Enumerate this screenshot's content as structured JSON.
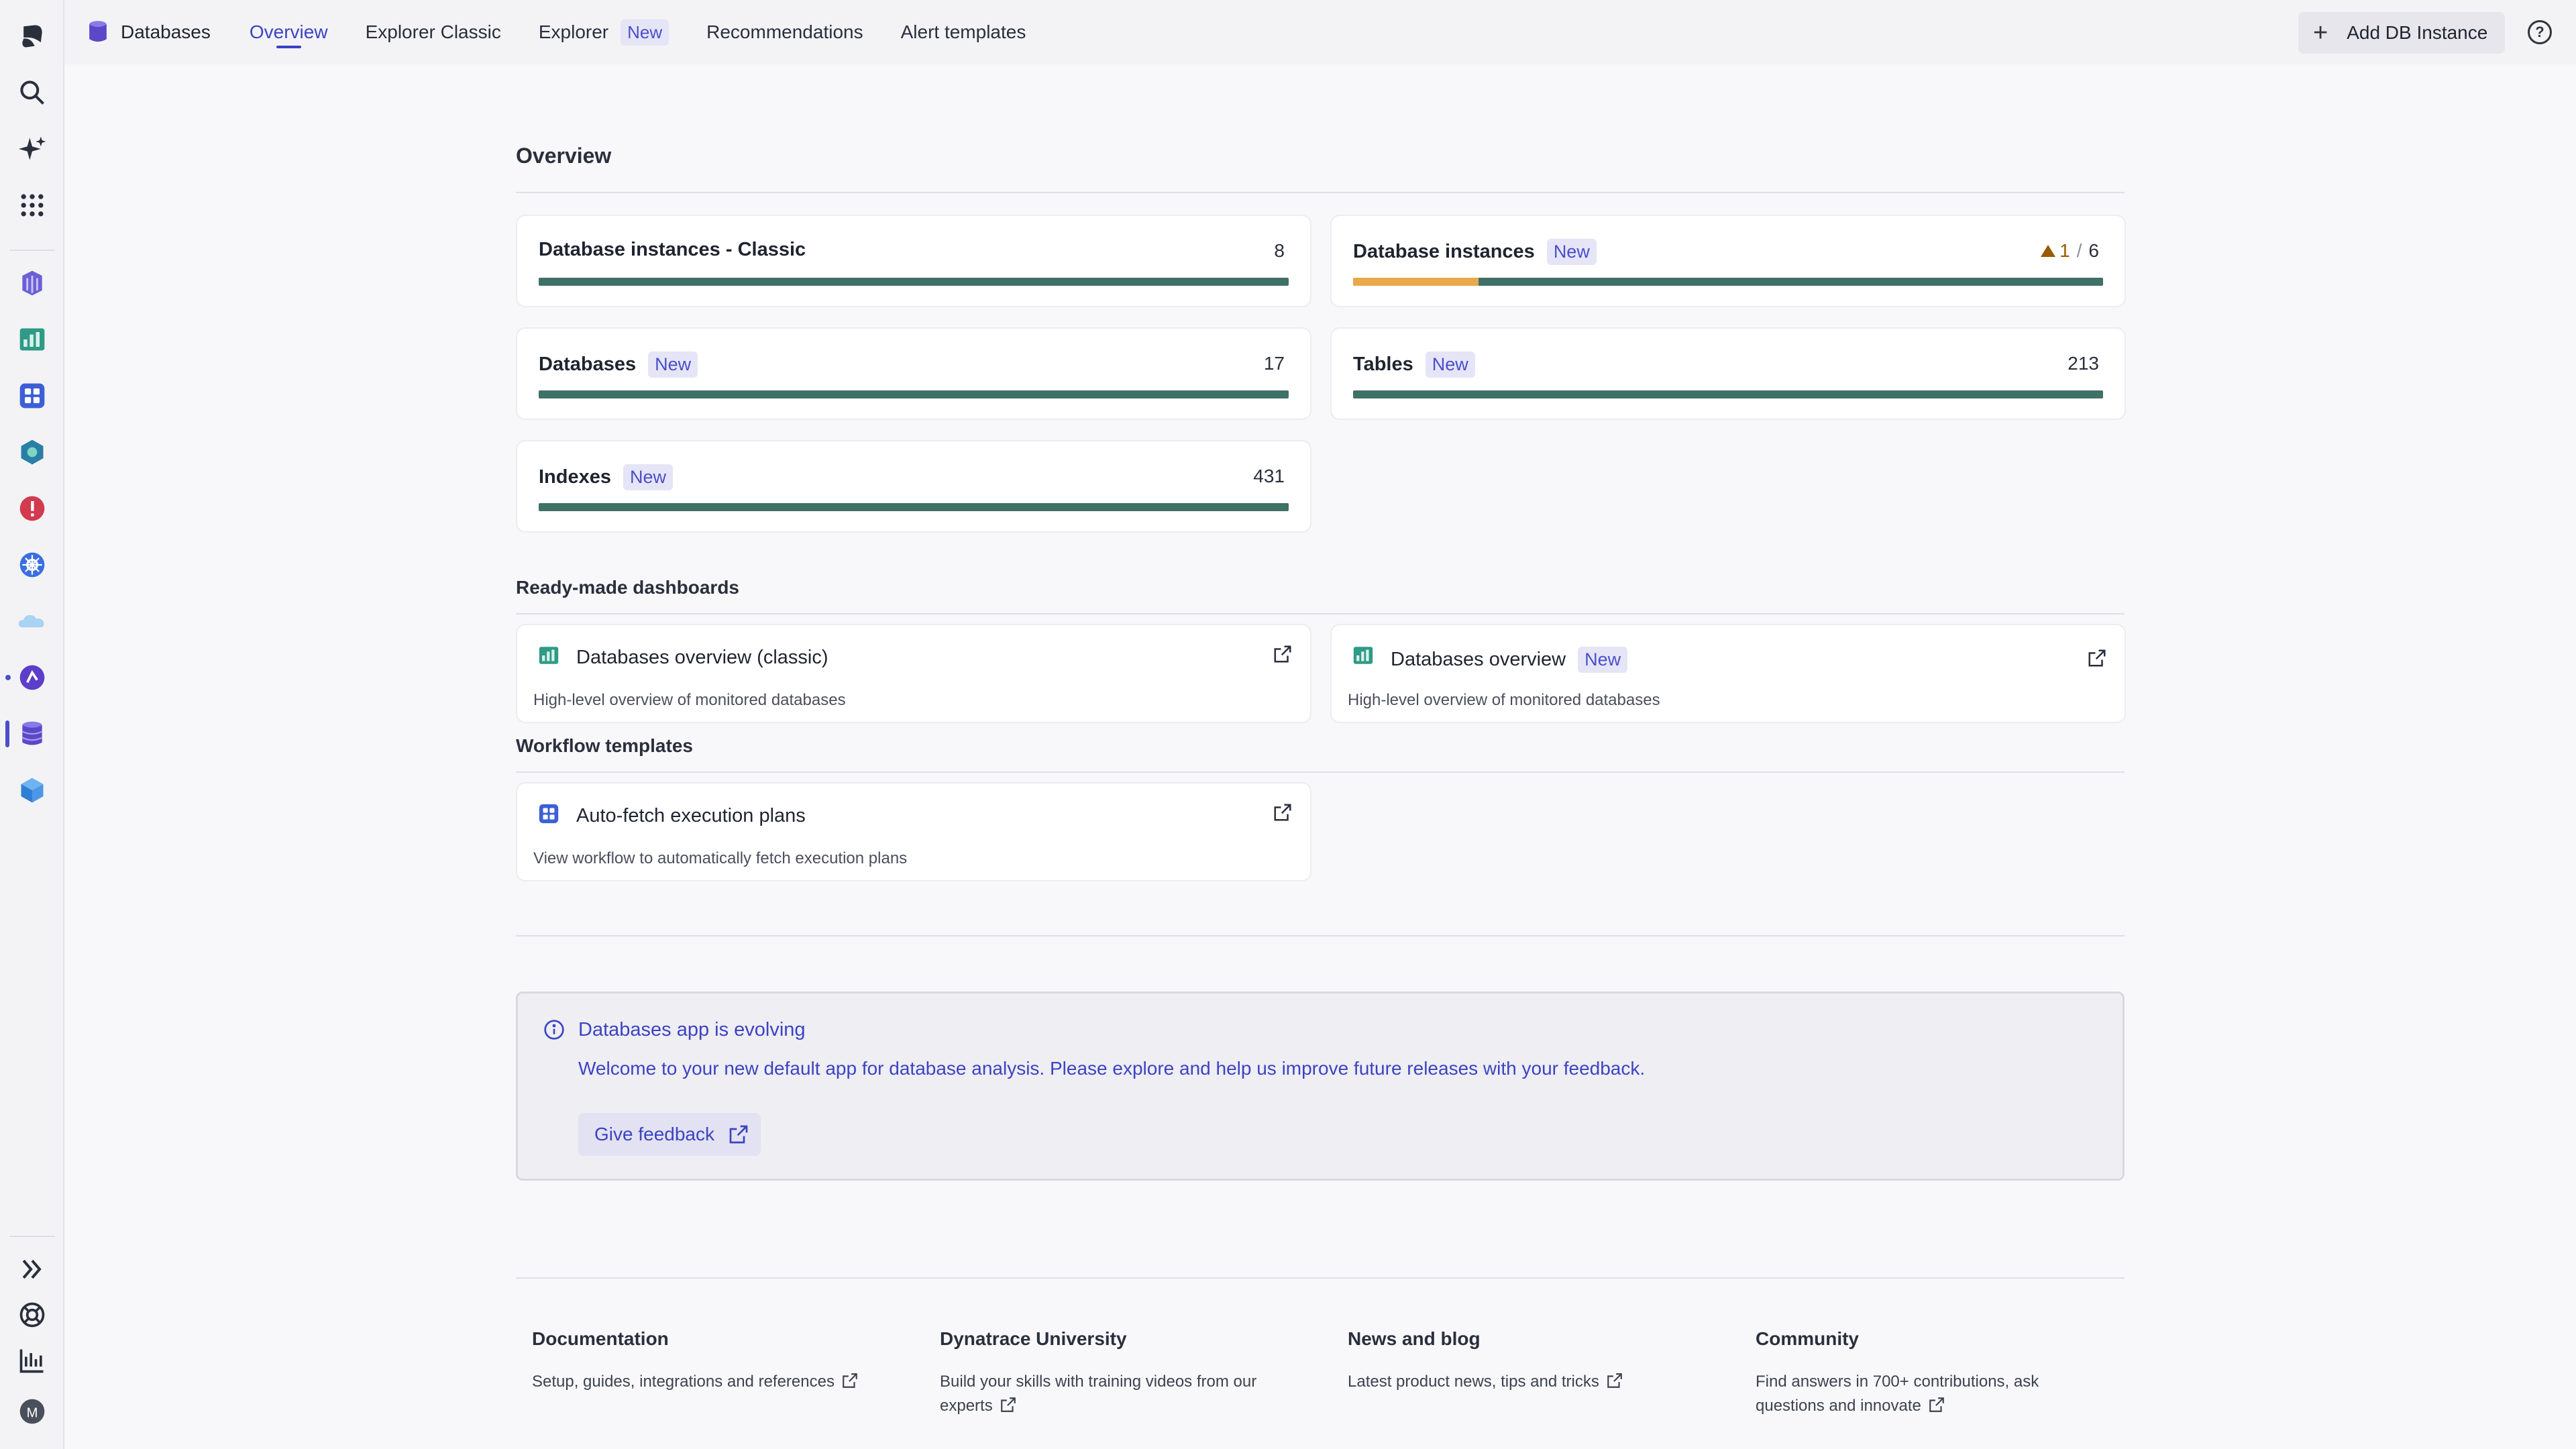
{
  "app": {
    "title": "Databases",
    "tabs": [
      {
        "label": "Overview",
        "active": true
      },
      {
        "label": "Explorer Classic"
      },
      {
        "label": "Explorer",
        "badge": "New"
      },
      {
        "label": "Recommendations"
      },
      {
        "label": "Alert templates"
      }
    ],
    "add_button": "Add DB Instance",
    "help": "?"
  },
  "rail": {
    "icons": [
      "dynatrace-logo-icon",
      "search-icon",
      "ai-sparkle-icon",
      "apps-grid-icon",
      "infrastructure-icon",
      "dashboards-icon",
      "workflows-icon",
      "services-icon",
      "problems-icon",
      "kubernetes-icon",
      "clouds-icon",
      "observability-icon",
      "databases-icon",
      "cube-icon"
    ],
    "bottom_icons": [
      "expand-icon",
      "support-icon",
      "analytics-icon",
      "avatar-icon"
    ],
    "avatar_initial": "M"
  },
  "overview": {
    "title": "Overview",
    "metrics": [
      {
        "label": "Database instances - Classic",
        "count": "8"
      },
      {
        "label": "Database instances",
        "badge": "New",
        "warn": "1",
        "sep": "/",
        "count": "6",
        "warn_fraction": 0.167
      },
      {
        "label": "Databases",
        "badge": "New",
        "count": "17"
      },
      {
        "label": "Tables",
        "badge": "New",
        "count": "213"
      },
      {
        "label": "Indexes",
        "badge": "New",
        "count": "431"
      }
    ]
  },
  "dashboards": {
    "title": "Ready-made dashboards",
    "items": [
      {
        "title": "Databases overview (classic)",
        "desc": "High-level overview of monitored databases"
      },
      {
        "title": "Databases overview",
        "badge": "New",
        "desc": "High-level overview of monitored databases"
      }
    ]
  },
  "workflows": {
    "title": "Workflow templates",
    "items": [
      {
        "title": "Auto-fetch execution plans",
        "desc": "View workflow to automatically fetch execution plans"
      }
    ]
  },
  "feedback": {
    "title": "Databases app is evolving",
    "text": "Welcome to your new default app for database analysis. Please explore and help us improve future releases with your feedback.",
    "button": "Give feedback"
  },
  "footer": [
    {
      "title": "Documentation",
      "text": "Setup, guides, integrations and references"
    },
    {
      "title": "Dynatrace University",
      "text": "Build your skills with training videos from our experts"
    },
    {
      "title": "News and blog",
      "text": "Latest product news, tips and tricks"
    },
    {
      "title": "Community",
      "text": "Find answers in 700+ contributions, ask questions and innovate"
    }
  ],
  "colors": {
    "accent": "#3d43c2",
    "bar": "#3f7167",
    "warning": "#e8a94a"
  }
}
